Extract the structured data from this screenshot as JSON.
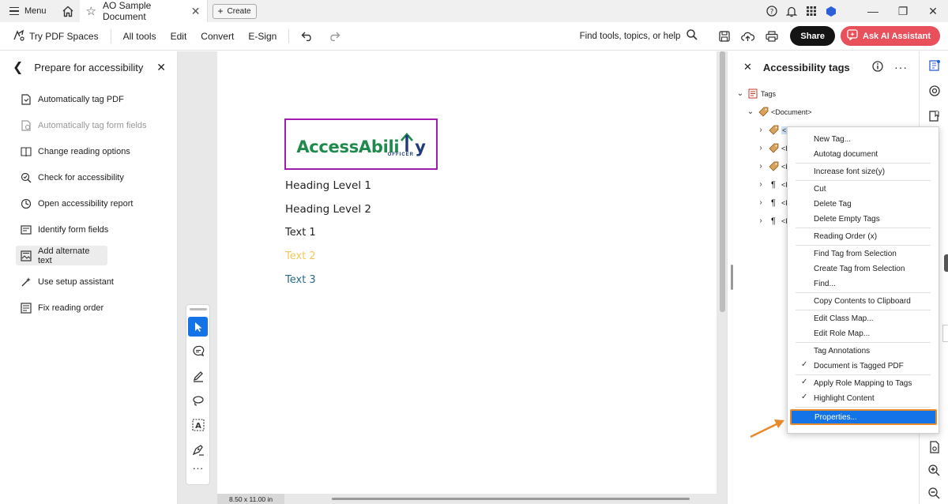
{
  "titlebar": {
    "menu_label": "Menu",
    "doc_tab_title": "AO Sample Document",
    "create_label": "Create"
  },
  "toolbar": {
    "try_spaces": "Try PDF Spaces",
    "all_tools": "All tools",
    "edit": "Edit",
    "convert": "Convert",
    "esign": "E-Sign",
    "find_tools": "Find tools, topics, or help",
    "share": "Share",
    "ask_ai": "Ask AI Assistant"
  },
  "left_panel": {
    "title": "Prepare for accessibility",
    "items": [
      {
        "label": "Automatically tag PDF",
        "icon": "auto-tag-icon",
        "disabled": false
      },
      {
        "label": "Automatically tag form fields",
        "icon": "auto-tag-form-icon",
        "disabled": true
      },
      {
        "label": "Change reading options",
        "icon": "reading-options-icon",
        "disabled": false
      },
      {
        "label": "Check for accessibility",
        "icon": "accessibility-check-icon",
        "disabled": false
      },
      {
        "label": "Open accessibility report",
        "icon": "report-icon",
        "disabled": false
      },
      {
        "label": "Identify form fields",
        "icon": "form-fields-icon",
        "disabled": false
      },
      {
        "label": "Add alternate text",
        "icon": "alt-text-icon",
        "disabled": false,
        "active": true
      },
      {
        "label": "Use setup assistant",
        "icon": "setup-assistant-icon",
        "disabled": false
      },
      {
        "label": "Fix reading order",
        "icon": "reading-order-icon",
        "disabled": false
      }
    ]
  },
  "document": {
    "logo_part1": "AccessAbili",
    "logo_part2": "y",
    "logo_sub": "OFFICER",
    "heading1": "Heading Level 1",
    "heading2": "Heading Level 2",
    "text1": "Text 1",
    "text2": "Text 2",
    "text3": "Text 3",
    "page_size": "8.50 x 11.00 in"
  },
  "right_panel": {
    "title": "Accessibility tags",
    "tree_root": "Tags",
    "tree_document": "<Document>",
    "tree_children": [
      "<F",
      "<H",
      "<H",
      "<P",
      "<P",
      "<P"
    ]
  },
  "context_menu": {
    "groups": [
      [
        {
          "label": "New Tag..."
        },
        {
          "label": "Autotag document"
        }
      ],
      [
        {
          "label": "Increase font size(y)"
        }
      ],
      [
        {
          "label": "Cut"
        },
        {
          "label": "Delete Tag"
        },
        {
          "label": "Delete Empty Tags"
        }
      ],
      [
        {
          "label": "Reading Order (x)"
        }
      ],
      [
        {
          "label": "Find Tag from Selection"
        },
        {
          "label": "Create Tag from Selection"
        },
        {
          "label": "Find..."
        }
      ],
      [
        {
          "label": "Copy Contents to Clipboard"
        }
      ],
      [
        {
          "label": "Edit Class Map..."
        },
        {
          "label": "Edit Role Map..."
        }
      ],
      [
        {
          "label": "Tag Annotations"
        },
        {
          "label": "Document is Tagged PDF",
          "checked": true
        }
      ],
      [
        {
          "label": "Apply Role Mapping to Tags",
          "checked": true
        },
        {
          "label": "Highlight Content",
          "checked": true
        }
      ],
      [
        {
          "label": "Properties...",
          "highlighted": true
        }
      ]
    ]
  },
  "colors": {
    "accent": "#1473e6",
    "highlight_border": "#e68a2e",
    "ai_button": "#e8505b",
    "logo_green": "#1e8a4c",
    "logo_blue": "#1e3a7a",
    "logo_border": "#a21caf"
  }
}
